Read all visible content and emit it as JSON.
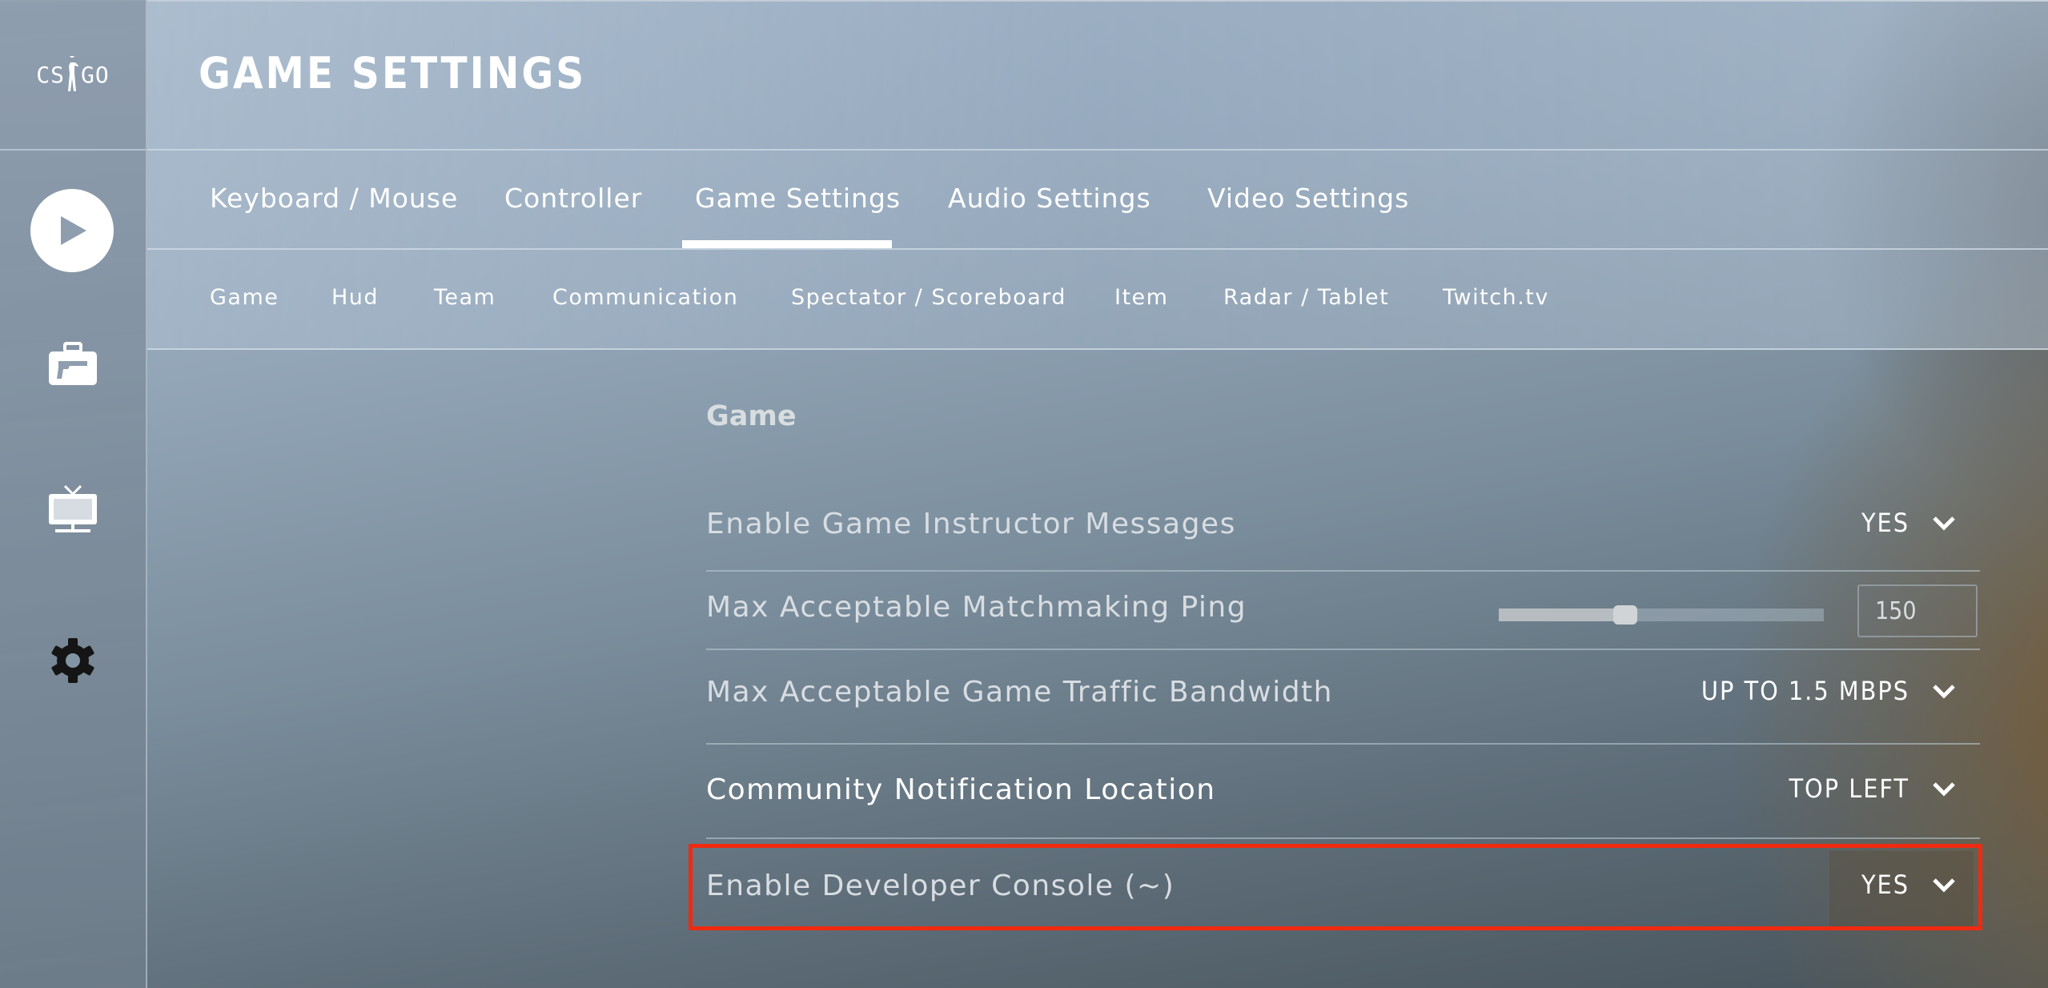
{
  "app": {
    "logo_left": "CS",
    "logo_right": "GO",
    "page_title": "GAME SETTINGS"
  },
  "sidebar": {
    "items": [
      {
        "name": "play",
        "icon": "play-icon"
      },
      {
        "name": "inventory",
        "icon": "briefcase-gun-icon"
      },
      {
        "name": "watch",
        "icon": "tv-icon"
      },
      {
        "name": "settings",
        "icon": "gear-icon"
      }
    ]
  },
  "tabs": {
    "items": [
      {
        "label": "Keyboard / Mouse"
      },
      {
        "label": "Controller"
      },
      {
        "label": "Game Settings",
        "active": true
      },
      {
        "label": "Audio Settings"
      },
      {
        "label": "Video Settings"
      }
    ]
  },
  "subtabs": {
    "items": [
      {
        "label": "Game",
        "active": true
      },
      {
        "label": "Hud"
      },
      {
        "label": "Team"
      },
      {
        "label": "Communication"
      },
      {
        "label": "Spectator / Scoreboard"
      },
      {
        "label": "Item"
      },
      {
        "label": "Radar / Tablet"
      },
      {
        "label": "Twitch.tv"
      }
    ]
  },
  "section": {
    "title": "Game",
    "rows": [
      {
        "label": "Enable Game Instructor Messages",
        "type": "dropdown",
        "value": "YES"
      },
      {
        "label": "Max Acceptable Matchmaking Ping",
        "type": "slider",
        "value": "150",
        "fraction": 0.39
      },
      {
        "label": "Max Acceptable Game Traffic Bandwidth",
        "type": "dropdown",
        "value": "UP TO 1.5 MBPS"
      },
      {
        "label": "Community Notification Location",
        "type": "dropdown",
        "value": "TOP LEFT"
      },
      {
        "label": "Enable Developer Console (~)",
        "type": "dropdown",
        "value": "YES",
        "highlighted": true
      }
    ]
  },
  "colors": {
    "highlight": "#f02a10"
  }
}
